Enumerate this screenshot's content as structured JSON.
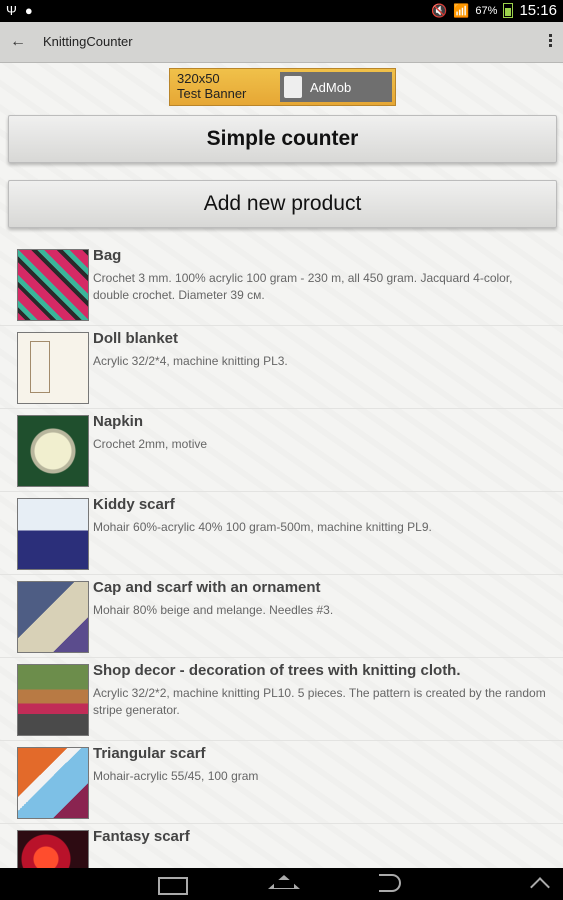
{
  "status_bar": {
    "battery": "67%",
    "time": "15:16",
    "icons": [
      "usb-icon",
      "notification-icon",
      "mute-icon",
      "wifi-icon",
      "battery-icon"
    ]
  },
  "action_bar": {
    "title": "KnittingCounter",
    "back_icon": "back-arrow-icon",
    "menu_icon": "overflow-menu-icon"
  },
  "ad": {
    "left_line1": "320x50",
    "left_line2": "Test Banner",
    "brand": "AdMob"
  },
  "buttons": {
    "simple_counter": "Simple counter",
    "add_new_product": "Add new product"
  },
  "products": [
    {
      "title": "Bag",
      "description": "Crochet 3 mm. 100% acrylic 100 gram - 230 m, all 450 gram. Jacquard 4-color, double crochet. Diameter 39 см."
    },
    {
      "title": "Doll blanket",
      "description": "Acrylic 32/2*4, machine knitting PL3."
    },
    {
      "title": "Napkin",
      "description": "Crochet 2mm, motive"
    },
    {
      "title": "Kiddy scarf",
      "description": "Mohair 60%-acrylic 40%  100 gram-500m, machine knitting PL9."
    },
    {
      "title": "Cap and scarf with an ornament",
      "description": "Mohair 80% beige and melange. Needles #3."
    },
    {
      "title": "Shop decor - decoration of trees with knitting cloth.",
      "description": "Acrylic 32/2*2, machine knitting PL10. 5 pieces. The pattern is created by the random stripe generator."
    },
    {
      "title": "Triangular scarf",
      "description": "Mohair-acrylic 55/45, 100 gram"
    },
    {
      "title": "Fantasy scarf",
      "description": ""
    }
  ],
  "nav_bar": {
    "icons": [
      "recents-icon",
      "home-icon",
      "back-icon",
      "chevron-up-icon"
    ]
  }
}
